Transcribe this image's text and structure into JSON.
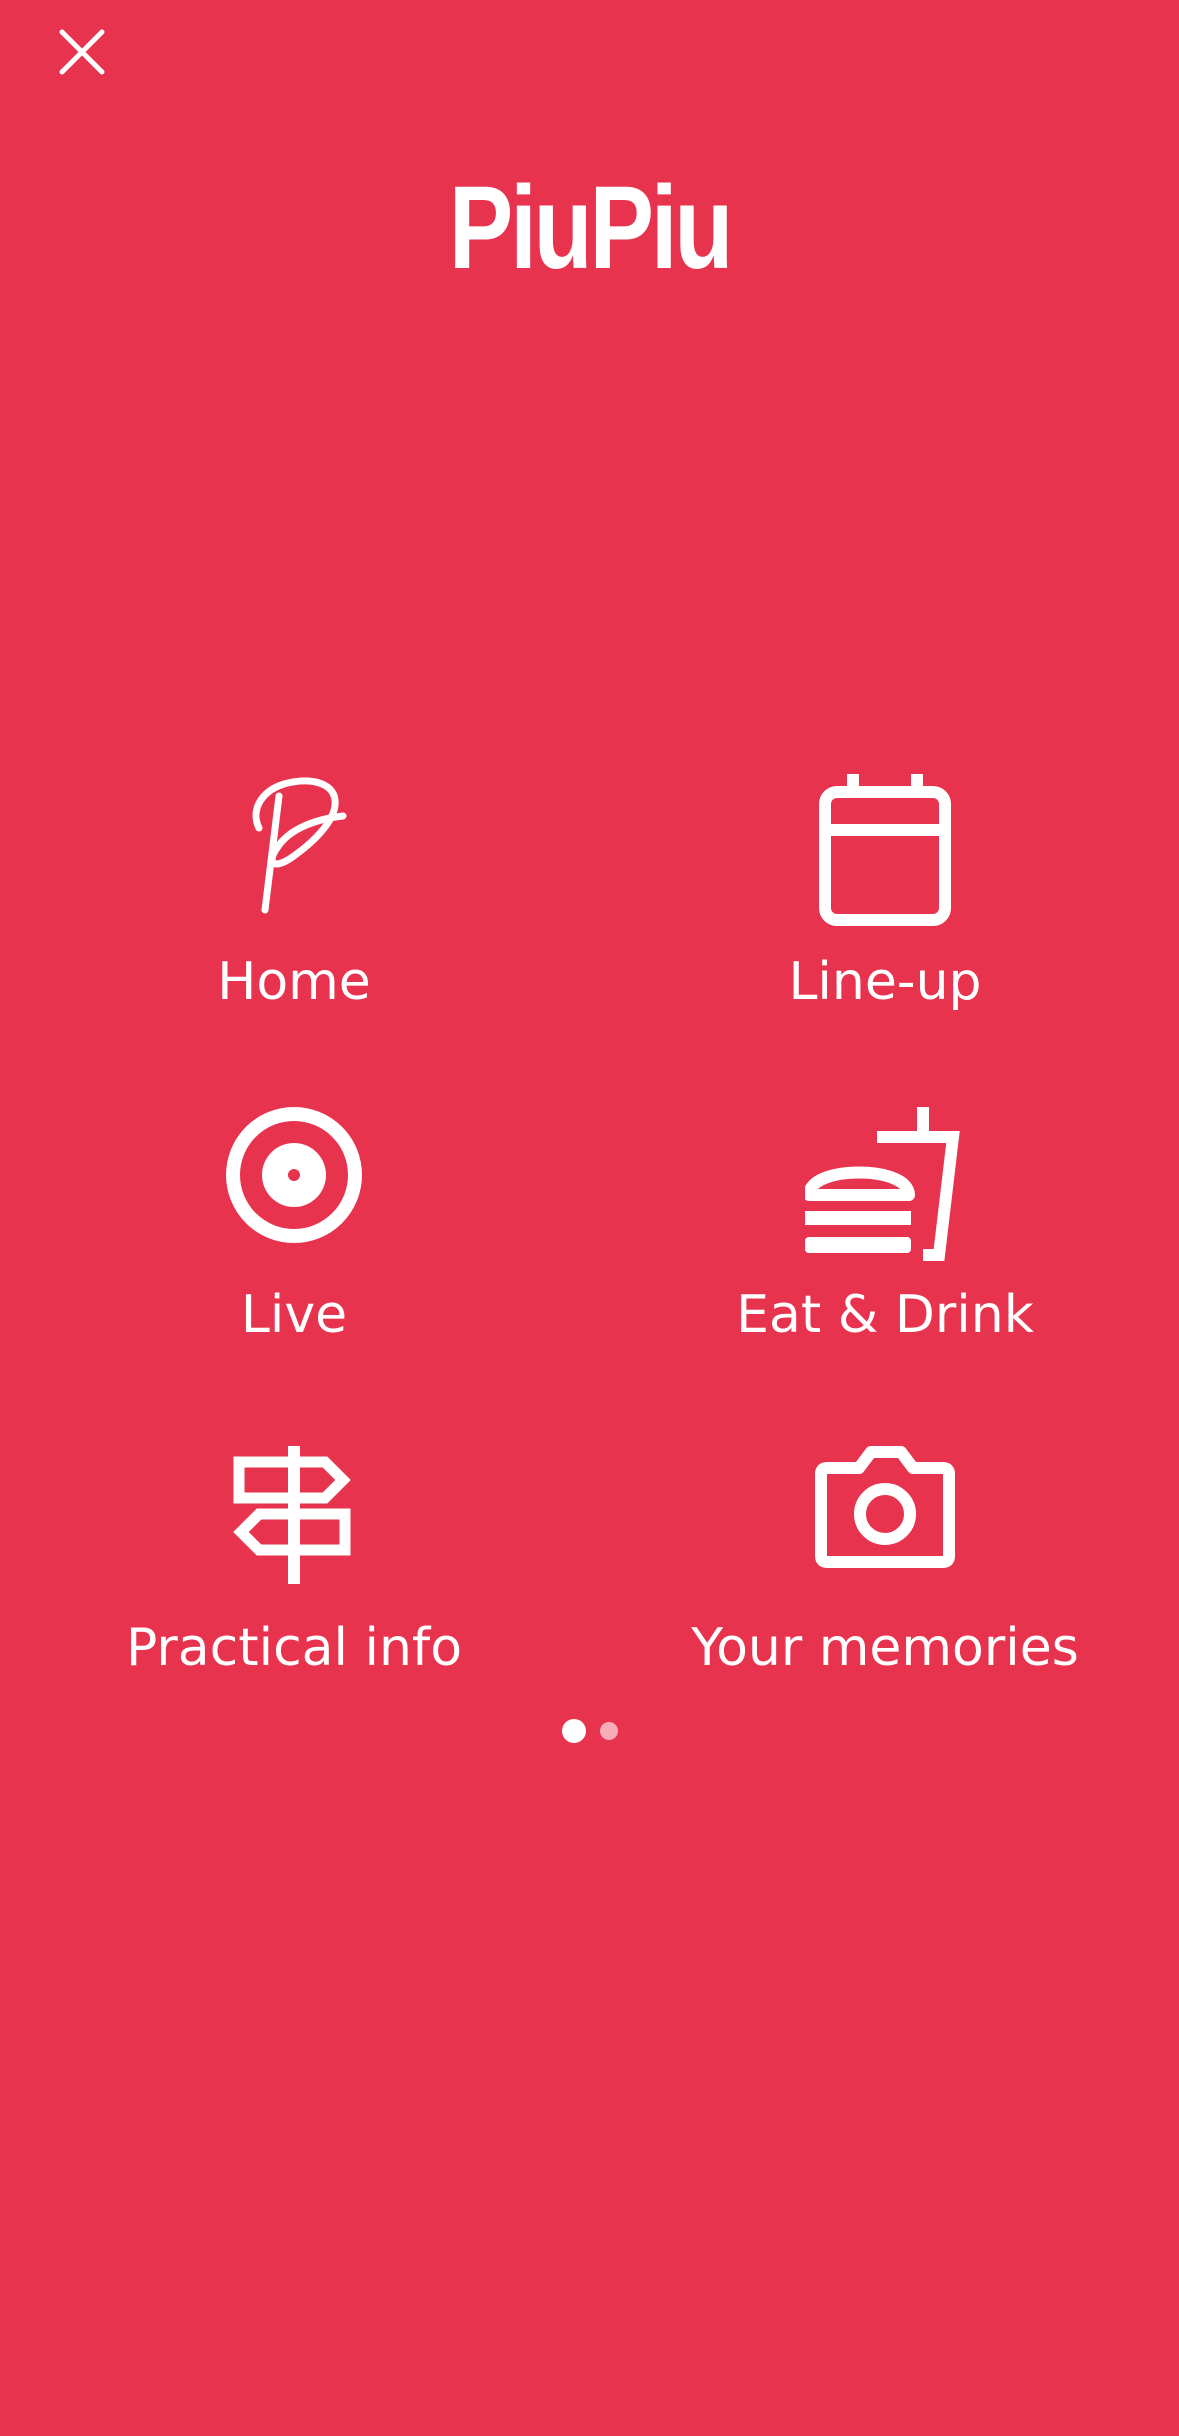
{
  "header": {
    "close_icon": "close-icon",
    "brand_title": "PiuPiu"
  },
  "menu": {
    "items": [
      {
        "label": "Home",
        "icon": "piupiu-p-logo-icon"
      },
      {
        "label": "Line-up",
        "icon": "calendar-icon"
      },
      {
        "label": "Live",
        "icon": "live-target-icon"
      },
      {
        "label": "Eat & Drink",
        "icon": "burger-drink-icon"
      },
      {
        "label": "Practical info",
        "icon": "signpost-icon"
      },
      {
        "label": "Your memories",
        "icon": "camera-icon"
      }
    ]
  },
  "pager": {
    "total_pages": 2,
    "current_page": 1
  },
  "colors": {
    "background": "#e8334e",
    "foreground": "#ffffff"
  }
}
